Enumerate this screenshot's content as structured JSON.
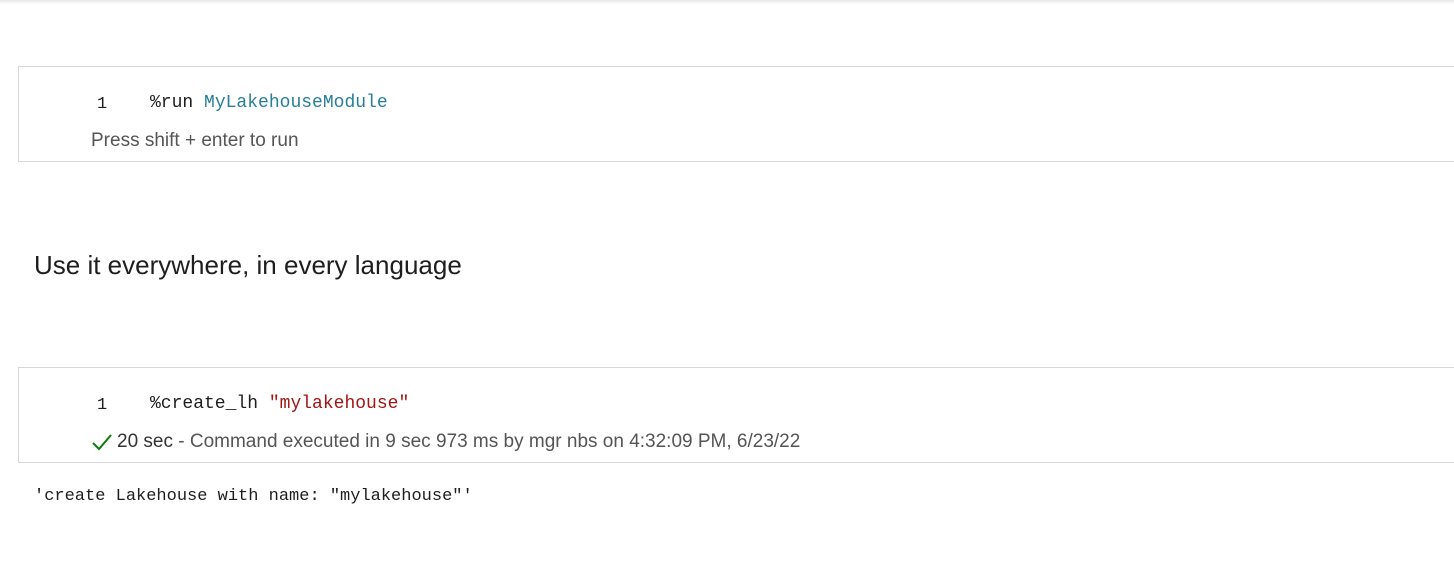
{
  "cell1": {
    "line_number": "1",
    "magic": "%run",
    "argument": "MyLakehouseModule",
    "hint": "Press shift + enter to run"
  },
  "heading": "Use it everywhere, in every language",
  "cell2": {
    "line_number": "1",
    "magic": "%create_lh",
    "argument": "\"mylakehouse\"",
    "status_icon": "checkmark-icon",
    "duration": "20 sec",
    "status_text": " - Command executed in 9 sec 973 ms by mgr nbs on 4:32:09 PM, 6/23/22",
    "output": "'create Lakehouse with name: \"mylakehouse\"'"
  },
  "colors": {
    "module_token": "#267f99",
    "string_token": "#a31515",
    "success": "#107c10",
    "border": "#d6d6d6"
  }
}
